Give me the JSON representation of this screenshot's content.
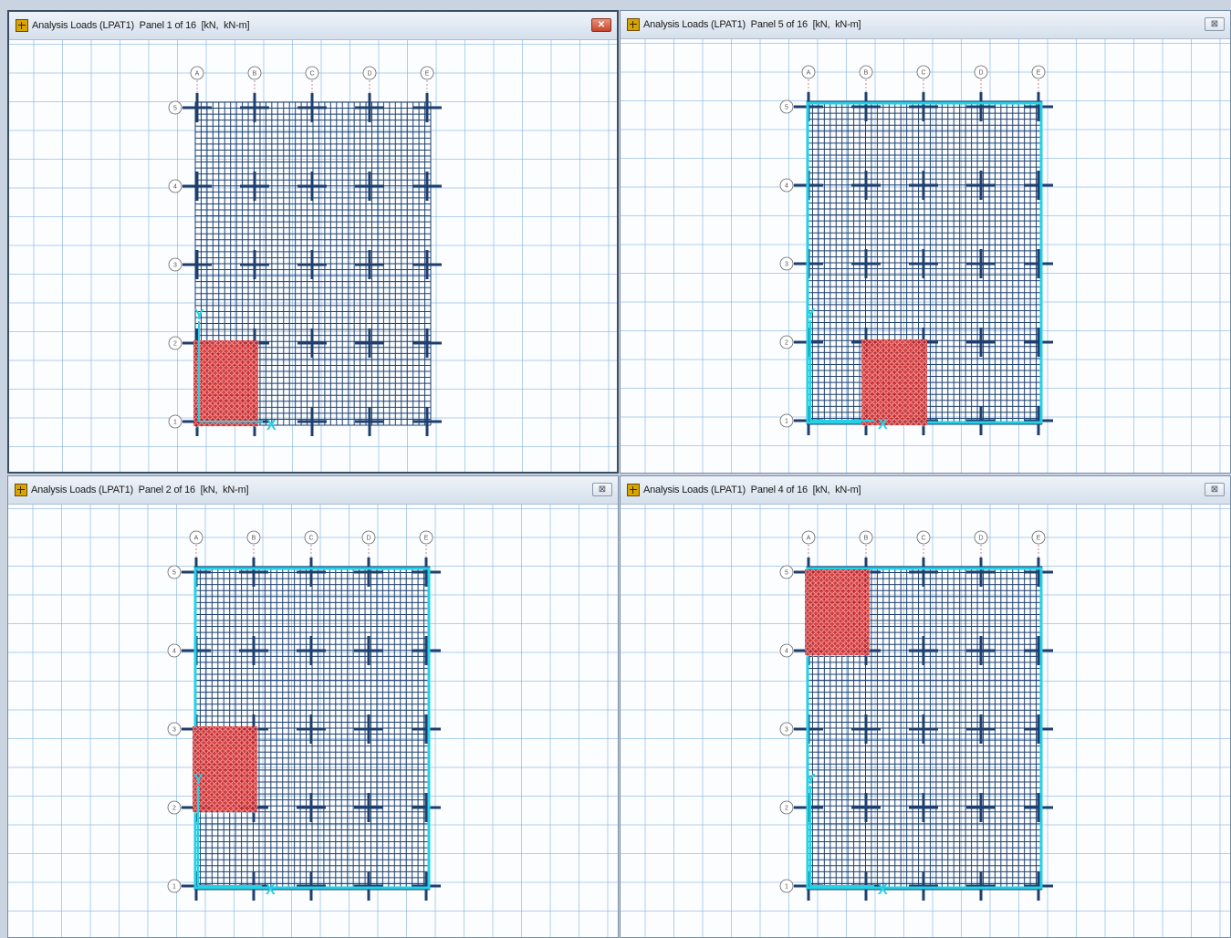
{
  "panels": [
    {
      "title": "Analysis Loads (LPAT1)  Panel 1 of 16  [kN,  kN-m]",
      "close_label": "✕",
      "active": true,
      "perimeter_highlight": false,
      "loaded_region": {
        "from_col": "A",
        "to_col": "B",
        "from_row": "1",
        "to_row": "2"
      }
    },
    {
      "title": "Analysis Loads (LPAT1)  Panel 5 of 16  [kN,  kN-m]",
      "close_label": "⊠",
      "active": false,
      "perimeter_highlight": true,
      "loaded_region": {
        "from_col": "B",
        "to_col": "C",
        "from_row": "1",
        "to_row": "2"
      }
    },
    {
      "title": "Analysis Loads (LPAT1)  Panel 2 of 16  [kN,  kN-m]",
      "close_label": "⊠",
      "active": false,
      "perimeter_highlight": true,
      "loaded_region": {
        "from_col": "A",
        "to_col": "B",
        "from_row": "2",
        "to_row": "3"
      }
    },
    {
      "title": "Analysis Loads (LPAT1)  Panel 4 of 16  [kN,  kN-m]",
      "close_label": "⊠",
      "active": false,
      "perimeter_highlight": true,
      "loaded_region": {
        "from_col": "A",
        "to_col": "B",
        "from_row": "4",
        "to_row": "5"
      }
    }
  ],
  "grid_axes": {
    "columns": [
      "A",
      "B",
      "C",
      "D",
      "E"
    ],
    "rows": [
      "1",
      "2",
      "3",
      "4",
      "5"
    ]
  },
  "axis_labels": {
    "x": "X",
    "y": "Y"
  },
  "colors": {
    "mesh": "#1e3f6e",
    "load": "#d42020",
    "perimeter": "#22d3e6",
    "grid": "#8fb8e0"
  }
}
